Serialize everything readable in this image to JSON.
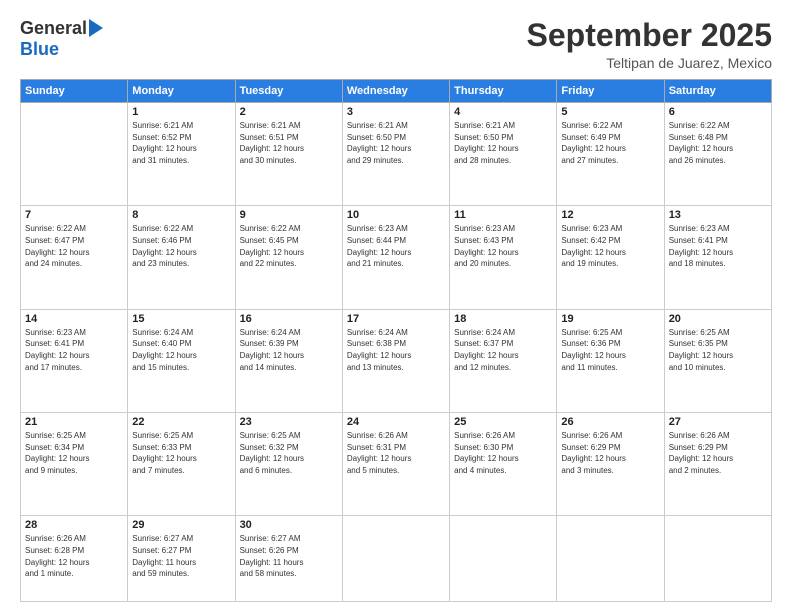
{
  "logo": {
    "general": "General",
    "blue": "Blue"
  },
  "header": {
    "month": "September 2025",
    "location": "Teltipan de Juarez, Mexico"
  },
  "weekdays": [
    "Sunday",
    "Monday",
    "Tuesday",
    "Wednesday",
    "Thursday",
    "Friday",
    "Saturday"
  ],
  "weeks": [
    [
      {
        "day": "",
        "info": ""
      },
      {
        "day": "1",
        "info": "Sunrise: 6:21 AM\nSunset: 6:52 PM\nDaylight: 12 hours\nand 31 minutes."
      },
      {
        "day": "2",
        "info": "Sunrise: 6:21 AM\nSunset: 6:51 PM\nDaylight: 12 hours\nand 30 minutes."
      },
      {
        "day": "3",
        "info": "Sunrise: 6:21 AM\nSunset: 6:50 PM\nDaylight: 12 hours\nand 29 minutes."
      },
      {
        "day": "4",
        "info": "Sunrise: 6:21 AM\nSunset: 6:50 PM\nDaylight: 12 hours\nand 28 minutes."
      },
      {
        "day": "5",
        "info": "Sunrise: 6:22 AM\nSunset: 6:49 PM\nDaylight: 12 hours\nand 27 minutes."
      },
      {
        "day": "6",
        "info": "Sunrise: 6:22 AM\nSunset: 6:48 PM\nDaylight: 12 hours\nand 26 minutes."
      }
    ],
    [
      {
        "day": "7",
        "info": "Sunrise: 6:22 AM\nSunset: 6:47 PM\nDaylight: 12 hours\nand 24 minutes."
      },
      {
        "day": "8",
        "info": "Sunrise: 6:22 AM\nSunset: 6:46 PM\nDaylight: 12 hours\nand 23 minutes."
      },
      {
        "day": "9",
        "info": "Sunrise: 6:22 AM\nSunset: 6:45 PM\nDaylight: 12 hours\nand 22 minutes."
      },
      {
        "day": "10",
        "info": "Sunrise: 6:23 AM\nSunset: 6:44 PM\nDaylight: 12 hours\nand 21 minutes."
      },
      {
        "day": "11",
        "info": "Sunrise: 6:23 AM\nSunset: 6:43 PM\nDaylight: 12 hours\nand 20 minutes."
      },
      {
        "day": "12",
        "info": "Sunrise: 6:23 AM\nSunset: 6:42 PM\nDaylight: 12 hours\nand 19 minutes."
      },
      {
        "day": "13",
        "info": "Sunrise: 6:23 AM\nSunset: 6:41 PM\nDaylight: 12 hours\nand 18 minutes."
      }
    ],
    [
      {
        "day": "14",
        "info": "Sunrise: 6:23 AM\nSunset: 6:41 PM\nDaylight: 12 hours\nand 17 minutes."
      },
      {
        "day": "15",
        "info": "Sunrise: 6:24 AM\nSunset: 6:40 PM\nDaylight: 12 hours\nand 15 minutes."
      },
      {
        "day": "16",
        "info": "Sunrise: 6:24 AM\nSunset: 6:39 PM\nDaylight: 12 hours\nand 14 minutes."
      },
      {
        "day": "17",
        "info": "Sunrise: 6:24 AM\nSunset: 6:38 PM\nDaylight: 12 hours\nand 13 minutes."
      },
      {
        "day": "18",
        "info": "Sunrise: 6:24 AM\nSunset: 6:37 PM\nDaylight: 12 hours\nand 12 minutes."
      },
      {
        "day": "19",
        "info": "Sunrise: 6:25 AM\nSunset: 6:36 PM\nDaylight: 12 hours\nand 11 minutes."
      },
      {
        "day": "20",
        "info": "Sunrise: 6:25 AM\nSunset: 6:35 PM\nDaylight: 12 hours\nand 10 minutes."
      }
    ],
    [
      {
        "day": "21",
        "info": "Sunrise: 6:25 AM\nSunset: 6:34 PM\nDaylight: 12 hours\nand 9 minutes."
      },
      {
        "day": "22",
        "info": "Sunrise: 6:25 AM\nSunset: 6:33 PM\nDaylight: 12 hours\nand 7 minutes."
      },
      {
        "day": "23",
        "info": "Sunrise: 6:25 AM\nSunset: 6:32 PM\nDaylight: 12 hours\nand 6 minutes."
      },
      {
        "day": "24",
        "info": "Sunrise: 6:26 AM\nSunset: 6:31 PM\nDaylight: 12 hours\nand 5 minutes."
      },
      {
        "day": "25",
        "info": "Sunrise: 6:26 AM\nSunset: 6:30 PM\nDaylight: 12 hours\nand 4 minutes."
      },
      {
        "day": "26",
        "info": "Sunrise: 6:26 AM\nSunset: 6:29 PM\nDaylight: 12 hours\nand 3 minutes."
      },
      {
        "day": "27",
        "info": "Sunrise: 6:26 AM\nSunset: 6:29 PM\nDaylight: 12 hours\nand 2 minutes."
      }
    ],
    [
      {
        "day": "28",
        "info": "Sunrise: 6:26 AM\nSunset: 6:28 PM\nDaylight: 12 hours\nand 1 minute."
      },
      {
        "day": "29",
        "info": "Sunrise: 6:27 AM\nSunset: 6:27 PM\nDaylight: 11 hours\nand 59 minutes."
      },
      {
        "day": "30",
        "info": "Sunrise: 6:27 AM\nSunset: 6:26 PM\nDaylight: 11 hours\nand 58 minutes."
      },
      {
        "day": "",
        "info": ""
      },
      {
        "day": "",
        "info": ""
      },
      {
        "day": "",
        "info": ""
      },
      {
        "day": "",
        "info": ""
      }
    ]
  ]
}
